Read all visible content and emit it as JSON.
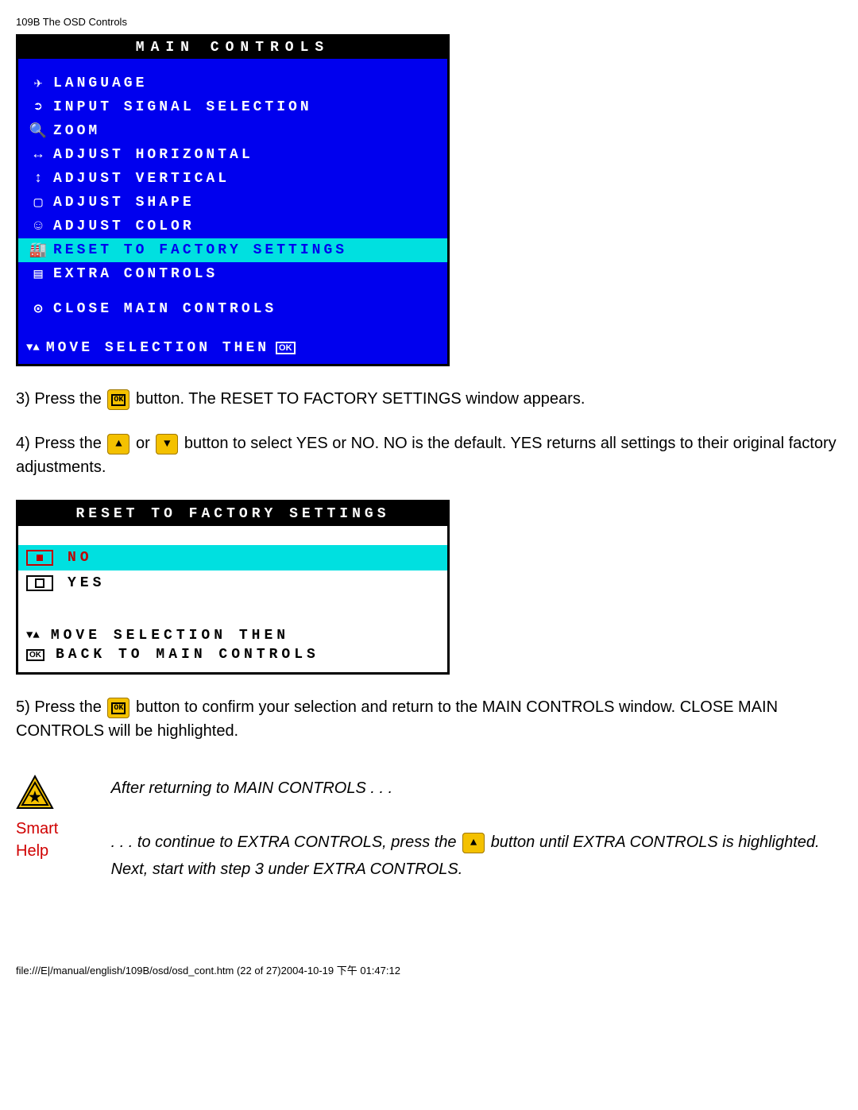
{
  "page_header": "109B The OSD Controls",
  "osd": {
    "title": "MAIN CONTROLS",
    "items": [
      "LANGUAGE",
      "INPUT SIGNAL SELECTION",
      "ZOOM",
      "ADJUST HORIZONTAL",
      "ADJUST VERTICAL",
      "ADJUST SHAPE",
      "ADJUST COLOR",
      "RESET TO FACTORY SETTINGS",
      "EXTRA CONTROLS"
    ],
    "close": "CLOSE MAIN CONTROLS",
    "help": "MOVE SELECTION THEN",
    "ok_label": "OK"
  },
  "instr3_a": "3) Press the ",
  "instr3_b": " button. The RESET TO FACTORY SETTINGS window appears.",
  "instr4_a": "4) Press the ",
  "instr4_or": " or ",
  "instr4_b": " button to select YES or NO. NO is the default. YES returns all settings to their original factory adjustments.",
  "reset": {
    "title": "RESET TO FACTORY SETTINGS",
    "no": "NO",
    "yes": "YES",
    "help1": "MOVE SELECTION THEN",
    "help2": "BACK TO MAIN CONTROLS",
    "ok": "OK"
  },
  "instr5_a": "5) Press the ",
  "instr5_b": " button to confirm your selection and return to the MAIN CONTROLS window. CLOSE MAIN CONTROLS will be highlighted.",
  "smart": {
    "label_smart": "Smart",
    "label_help": "Help",
    "line1": "After returning to MAIN CONTROLS . . .",
    "line2a": ". . . to continue to EXTRA CONTROLS, press the ",
    "line2b": " button until EXTRA CONTROLS is highlighted. Next, start with step 3 under EXTRA CONTROLS."
  },
  "footer": "file:///E|/manual/english/109B/osd/osd_cont.htm (22 of 27)2004-10-19 下午 01:47:12"
}
